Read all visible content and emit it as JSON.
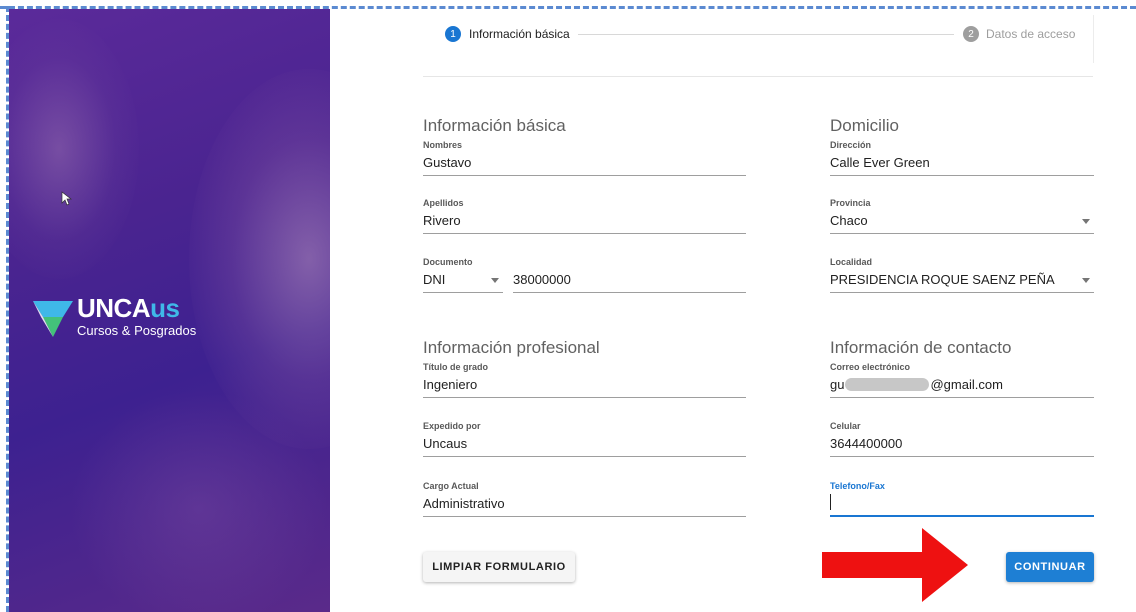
{
  "brand": {
    "name_main": "UNCA",
    "name_accent": "us",
    "subtitle": "Cursos & Posgrados"
  },
  "stepper": {
    "steps": [
      {
        "number": "1",
        "label": "Información básica"
      },
      {
        "number": "2",
        "label": "Datos de acceso"
      }
    ]
  },
  "sections": {
    "basic": {
      "title": "Información básica",
      "nombres": {
        "label": "Nombres",
        "value": "Gustavo"
      },
      "apellidos": {
        "label": "Apellidos",
        "value": "Rivero"
      },
      "documento": {
        "label": "Documento",
        "type": "DNI",
        "value": "38000000"
      }
    },
    "address": {
      "title": "Domicilio",
      "direccion": {
        "label": "Dirección",
        "value": "Calle Ever Green"
      },
      "provincia": {
        "label": "Provincia",
        "value": "Chaco"
      },
      "localidad": {
        "label": "Localidad",
        "value": "PRESIDENCIA ROQUE SAENZ PEÑA"
      }
    },
    "professional": {
      "title": "Información profesional",
      "titulo": {
        "label": "Título de grado",
        "value": "Ingeniero"
      },
      "expedido": {
        "label": "Expedido por",
        "value": "Uncaus"
      },
      "cargo": {
        "label": "Cargo Actual",
        "value": "Administrativo"
      }
    },
    "contact": {
      "title": "Información de contacto",
      "correo": {
        "label": "Correo electrónico",
        "value_prefix": "gu",
        "value_suffix": "@gmail.com"
      },
      "celular": {
        "label": "Celular",
        "value": "3644400000"
      },
      "telefono": {
        "label": "Telefono/Fax",
        "value": ""
      }
    }
  },
  "buttons": {
    "clear": "LIMPIAR FORMULARIO",
    "continue": "CONTINUAR"
  },
  "colors": {
    "primary": "#1976d2",
    "annotation_arrow": "#ee1111",
    "hero_purple": "#4a2490",
    "brand_accent": "#3fb8e8"
  }
}
